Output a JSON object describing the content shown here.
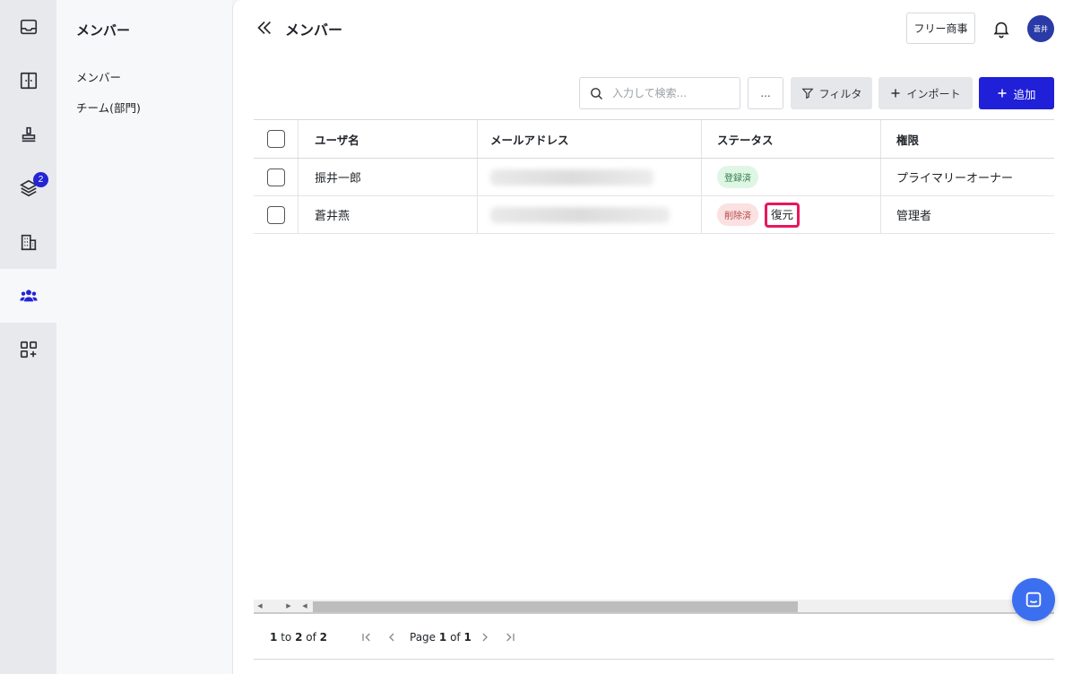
{
  "rail": {
    "items": [
      {
        "icon": "inbox-icon"
      },
      {
        "icon": "layout-icon"
      },
      {
        "icon": "stamp-icon"
      },
      {
        "icon": "layers-icon",
        "badge": "2"
      },
      {
        "icon": "building-icon"
      },
      {
        "icon": "members-icon",
        "active": true
      },
      {
        "icon": "apps-add-icon"
      }
    ]
  },
  "subnav": {
    "title": "メンバー",
    "links": [
      "メンバー",
      "チーム(部門)"
    ]
  },
  "header": {
    "title": "メンバー",
    "org_button": "フリー商事",
    "avatar_text": "蒼井"
  },
  "toolbar": {
    "search_placeholder": "入力して検索...",
    "more_label": "...",
    "filter_label": "フィルタ",
    "import_label": "インポート",
    "add_label": "追加"
  },
  "table": {
    "columns": [
      "ユーザ名",
      "メールアドレス",
      "ステータス",
      "権限"
    ],
    "rows": [
      {
        "name": "振井一郎",
        "status": "登録済",
        "status_type": "ok",
        "role": "プライマリーオーナー"
      },
      {
        "name": "蒼井燕",
        "status": "削除済",
        "status_type": "del",
        "action": "復元",
        "role": "管理者"
      }
    ]
  },
  "pager": {
    "from": "1",
    "to_label": "to",
    "to": "2",
    "of_label": "of",
    "total": "2",
    "page_label": "Page",
    "page": "1",
    "page_of_label": "of",
    "pages": "1"
  },
  "colors": {
    "accent": "#2020d8",
    "highlight": "#e8175d",
    "fab": "#3c6ff0"
  }
}
